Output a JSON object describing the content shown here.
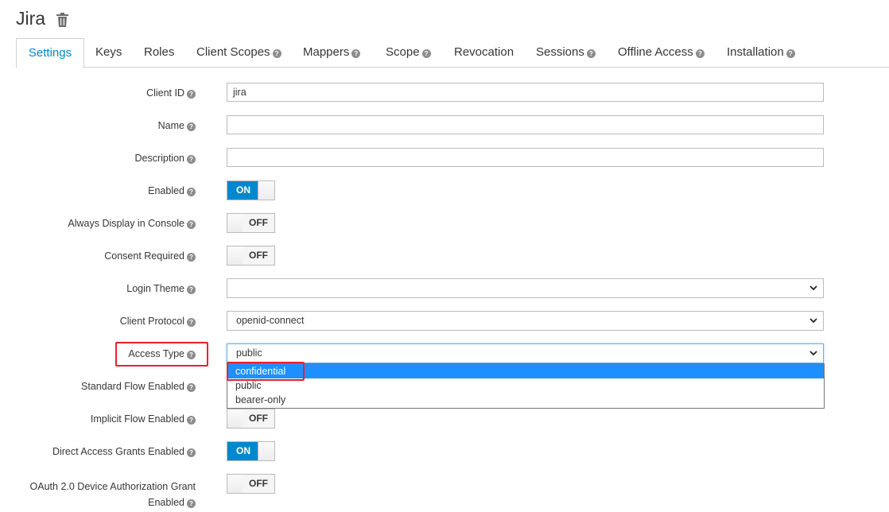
{
  "header": {
    "title": "Jira"
  },
  "tabs": [
    {
      "label": "Settings",
      "help": false
    },
    {
      "label": "Keys",
      "help": false
    },
    {
      "label": "Roles",
      "help": false
    },
    {
      "label": "Client Scopes",
      "help": true
    },
    {
      "label": "Mappers",
      "help": true
    },
    {
      "label": "Scope",
      "help": true
    },
    {
      "label": "Revocation",
      "help": false
    },
    {
      "label": "Sessions",
      "help": true
    },
    {
      "label": "Offline Access",
      "help": true
    },
    {
      "label": "Installation",
      "help": true
    }
  ],
  "help_glyph": "?",
  "form": {
    "client_id": {
      "label": "Client ID",
      "value": "jira"
    },
    "name": {
      "label": "Name",
      "value": ""
    },
    "description": {
      "label": "Description",
      "value": ""
    },
    "enabled": {
      "label": "Enabled",
      "state": "ON"
    },
    "always_display": {
      "label": "Always Display in Console",
      "state": "OFF"
    },
    "consent_required": {
      "label": "Consent Required",
      "state": "OFF"
    },
    "login_theme": {
      "label": "Login Theme",
      "value": ""
    },
    "client_protocol": {
      "label": "Client Protocol",
      "value": "openid-connect"
    },
    "access_type": {
      "label": "Access Type",
      "value": "public",
      "options": [
        "confidential",
        "public",
        "bearer-only"
      ],
      "highlighted_option": "confidential"
    },
    "standard_flow": {
      "label": "Standard Flow Enabled"
    },
    "implicit_flow": {
      "label": "Implicit Flow Enabled",
      "state": "OFF"
    },
    "direct_access": {
      "label": "Direct Access Grants Enabled",
      "state": "ON"
    },
    "device_grant": {
      "label_line1": "OAuth 2.0 Device Authorization Grant",
      "label_line2": "Enabled",
      "state": "OFF"
    }
  },
  "colors": {
    "accent": "#0088ce",
    "annotation": "#e8212a",
    "dropdown_selected": "#1e90ff"
  }
}
